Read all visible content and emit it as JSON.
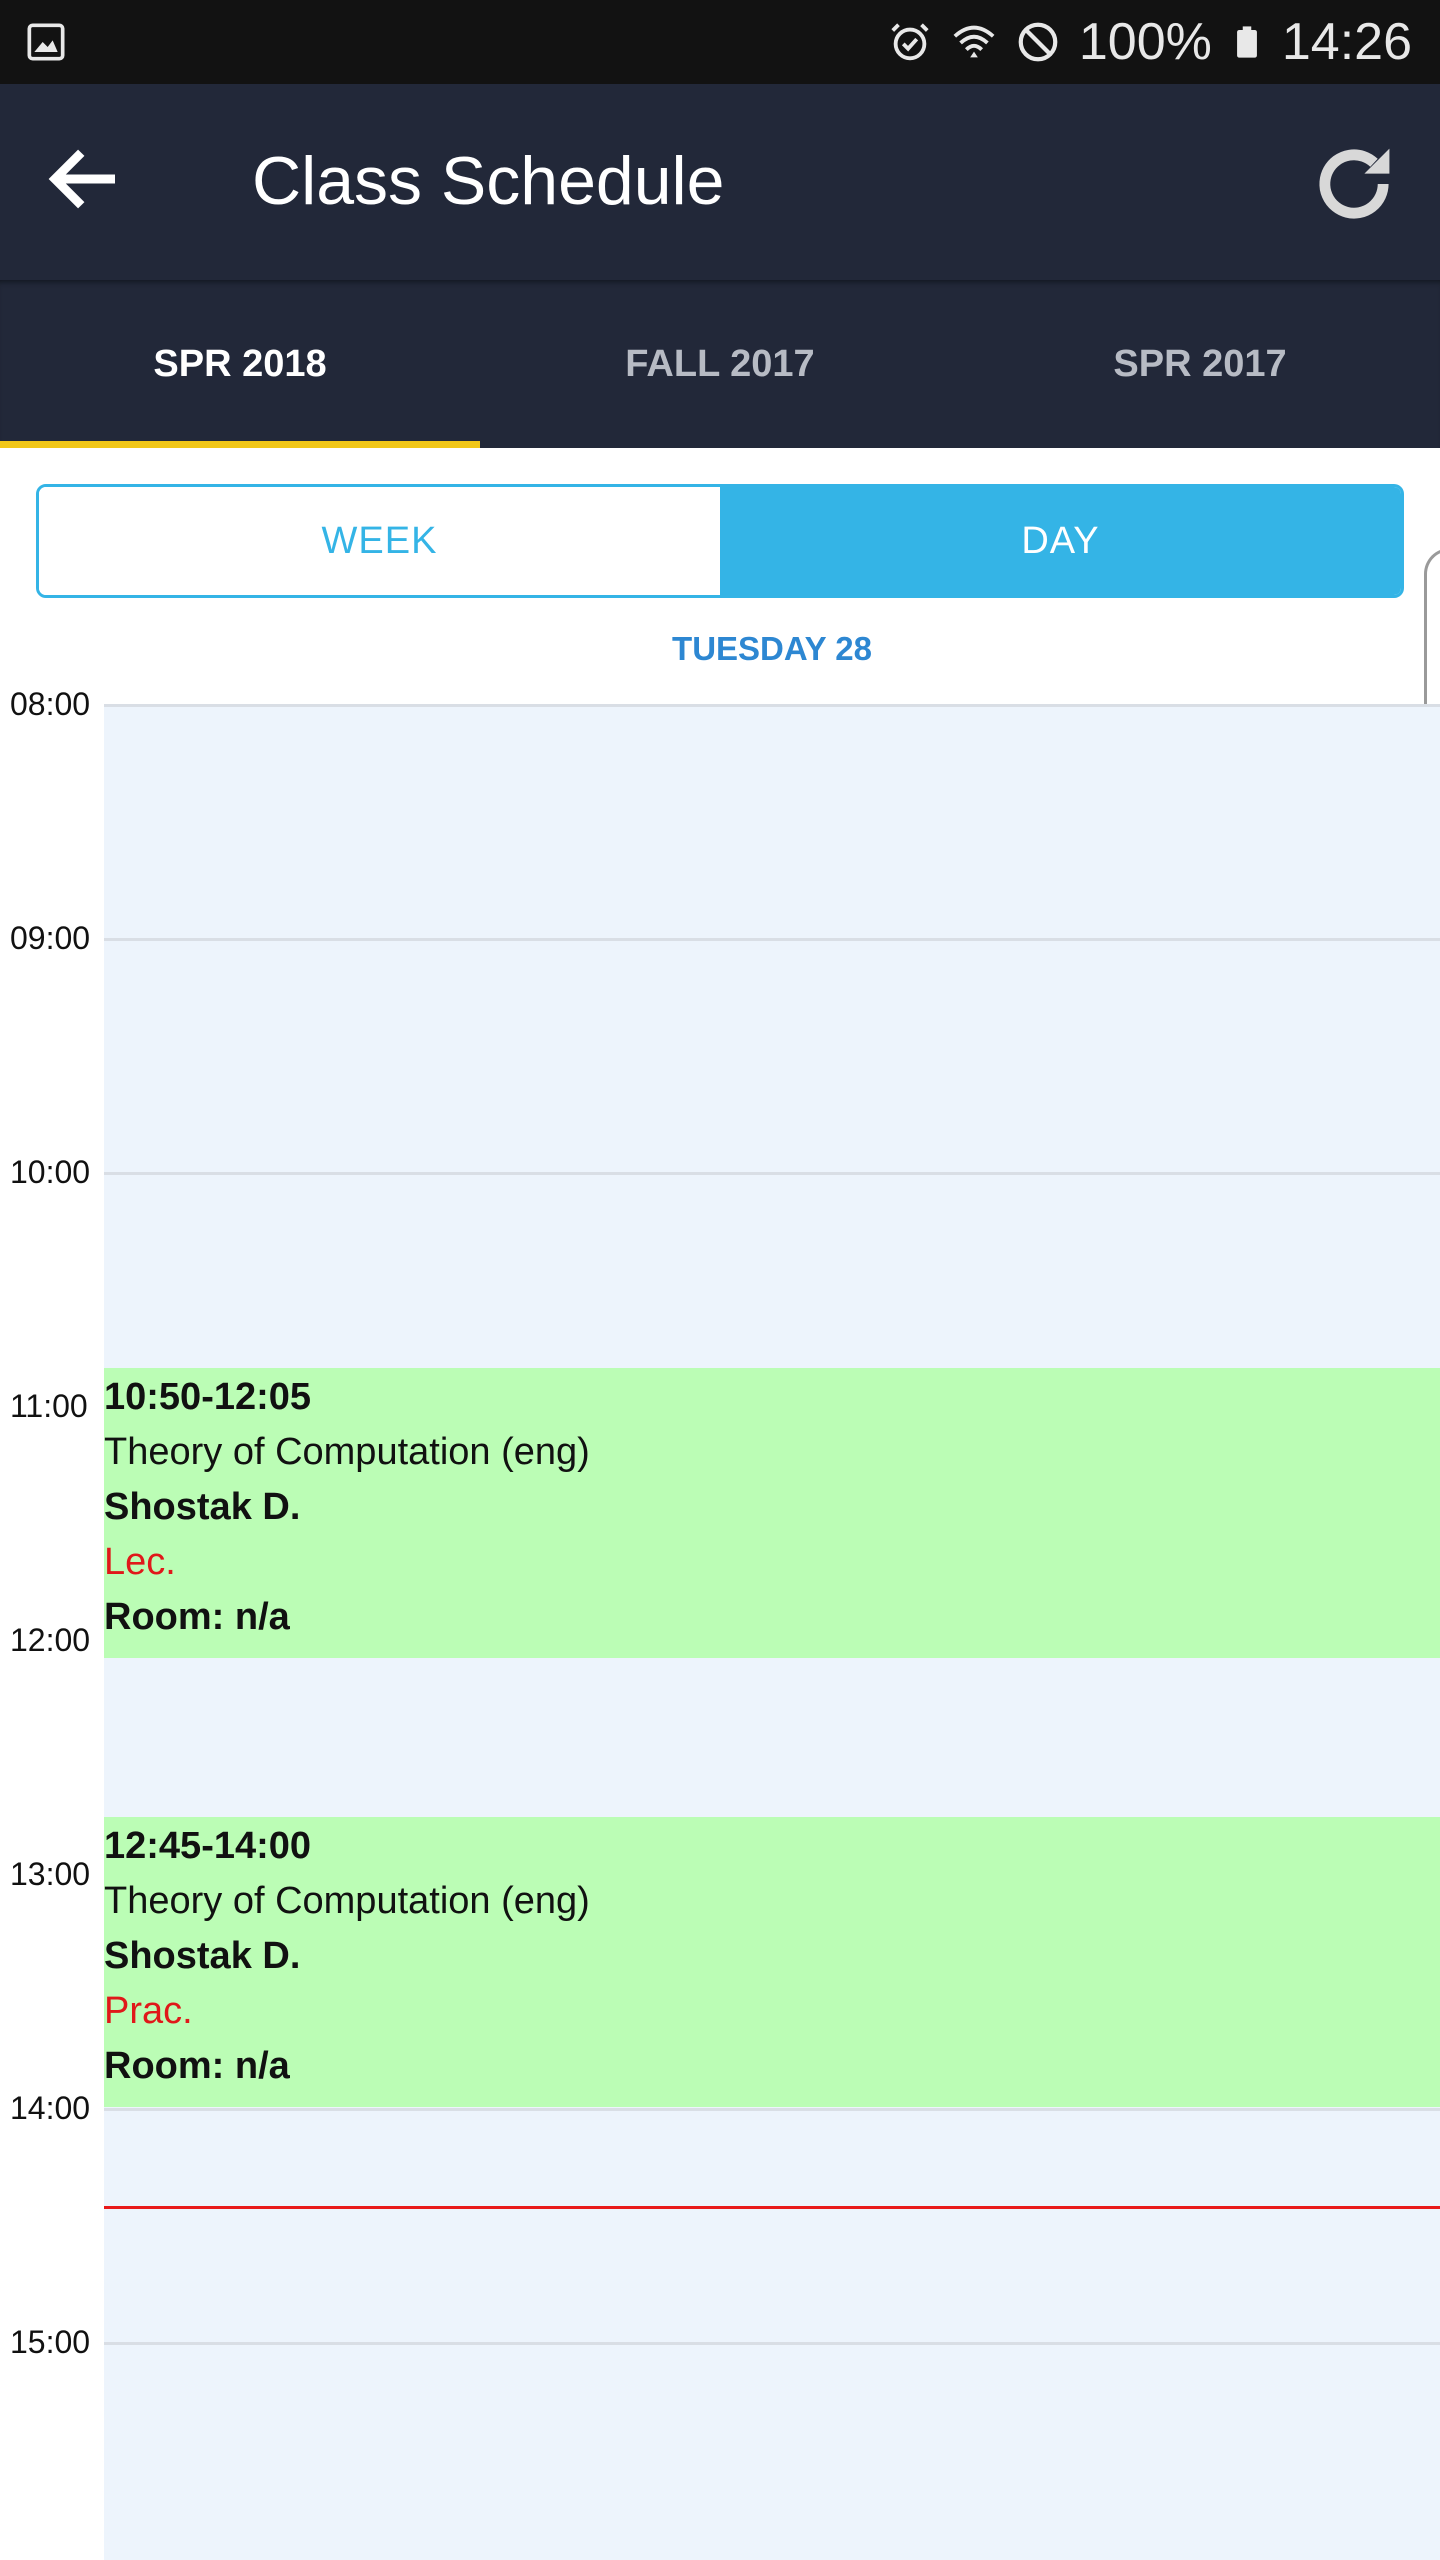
{
  "status_bar": {
    "battery": "100%",
    "time": "14:26",
    "icons": [
      "image-icon",
      "alarm-icon",
      "wifi-icon",
      "do-not-disturb-icon",
      "battery-icon"
    ]
  },
  "app_bar": {
    "title": "Class Schedule",
    "back_icon": "arrow-left-icon",
    "refresh_icon": "refresh-icon",
    "background": "#222839"
  },
  "tabs": [
    {
      "label": "SPR 2018",
      "active": true
    },
    {
      "label": "FALL 2017",
      "active": false
    },
    {
      "label": "SPR 2017",
      "active": false
    }
  ],
  "view_toggle": {
    "week_label": "WEEK",
    "day_label": "DAY",
    "selected": "DAY",
    "accent": "#34b4e6"
  },
  "day_header": "TUESDAY 28",
  "time_labels": [
    "08:00",
    "09:00",
    "10:00",
    "11:00",
    "12:00",
    "13:00",
    "14:00",
    "15:00"
  ],
  "events": [
    {
      "time": "10:50-12:05",
      "course": "Theory of Computation (eng)",
      "instructor": "Shostak D.",
      "type": "Lec.",
      "room": "Room: n/a"
    },
    {
      "time": "12:45-14:00",
      "course": "Theory of Computation (eng)",
      "instructor": "Shostak D.",
      "type": "Prac.",
      "room": "Room: n/a"
    }
  ],
  "colors": {
    "event_background": "#bbfdb5",
    "event_type_text": "#e0181a",
    "current_time_line": "#e8191a",
    "tab_indicator": "#f2c719",
    "grid_background": "#edf4fc"
  }
}
